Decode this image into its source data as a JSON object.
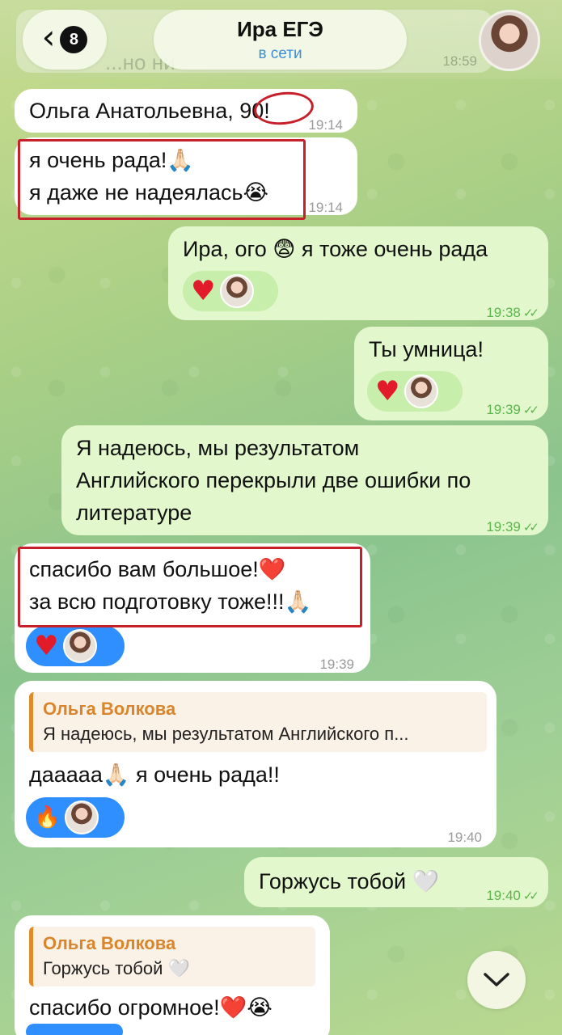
{
  "header": {
    "back_badge": "8",
    "title": "Ира ЕГЭ",
    "status": "в сети",
    "ghost_text": "...но ни",
    "ghost_time": "18:59"
  },
  "messages": [
    {
      "id": "m1",
      "side": "in",
      "lines": [
        "Ольга Анатольевна, 90!"
      ],
      "time": "19:14"
    },
    {
      "id": "m2",
      "side": "in",
      "lines": [
        "я очень рада!🙏🏻",
        "я даже не надеялась😭"
      ],
      "time": "19:14"
    },
    {
      "id": "m3",
      "side": "out",
      "lines": [
        "Ира, ого 😨 я тоже очень рада"
      ],
      "time": "19:38",
      "reaction": "heart-icon"
    },
    {
      "id": "m4",
      "side": "out",
      "lines": [
        "Ты умница!"
      ],
      "time": "19:39",
      "reaction": "heart-icon"
    },
    {
      "id": "m5",
      "side": "out",
      "lines": [
        "Я надеюсь, мы результатом",
        "Английского перекрыли две ошибки по",
        "литературе"
      ],
      "time": "19:39"
    },
    {
      "id": "m6",
      "side": "in",
      "lines": [
        "спасибо вам большое!❤️",
        "за всю подготовку тоже!!!🙏🏻"
      ],
      "time": "19:39",
      "reaction": "heart-icon"
    },
    {
      "id": "m7",
      "side": "in",
      "reply_name": "Ольга Волкова",
      "reply_text": "Я надеюсь, мы результатом Английского п...",
      "lines": [
        "дааааа🙏🏻 я очень рада!!"
      ],
      "time": "19:40",
      "reaction": "fire-icon"
    },
    {
      "id": "m8",
      "side": "out",
      "lines": [
        "Горжусь тобой 🤍"
      ],
      "time": "19:40"
    },
    {
      "id": "m9",
      "side": "in",
      "reply_name": "Ольга Волкова",
      "reply_text": "Горжусь тобой 🤍",
      "lines": [
        "спасибо огромное!❤️😭"
      ]
    }
  ],
  "colors": {
    "incoming_bubble": "#ffffff",
    "outgoing_bubble": "#e2f7cb",
    "accent_blue": "#2f8fff",
    "reply_accent": "#d9852c",
    "annotation_red": "#c8202a"
  },
  "icons": {
    "back": "chevron-left-icon",
    "scroll_down": "chevron-down-icon",
    "read_receipt": "double-check-icon"
  }
}
